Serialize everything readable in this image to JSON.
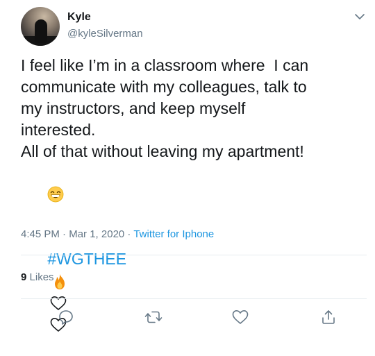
{
  "author": {
    "name": "Kyle",
    "handle": "@kyleSilverman"
  },
  "tweet": {
    "lines": [
      "I feel like I’m in a classroom where  I can",
      "communicate with my colleagues, talk to",
      "my instructors, and keep myself",
      "interested.",
      "All of that without leaving my apartment!"
    ],
    "emoji_line": "grinning-face-emoji",
    "hashtag": "#WGTHEE",
    "hashtag_icons": [
      "fire-emoji",
      "white-heart-emoji",
      "white-heart-emoji"
    ]
  },
  "meta": {
    "time": "4:45 PM",
    "separator1": " · ",
    "date": "Mar 1, 2020",
    "separator2": " · ",
    "source": "Twitter for Iphone"
  },
  "stats": {
    "likes_count": "9",
    "likes_label": "Likes"
  },
  "actions": [
    "reply-icon",
    "retweet-icon",
    "like-icon",
    "share-icon"
  ],
  "colors": {
    "link": "#1b95e0",
    "secondary_text": "#657786",
    "primary_text": "#14171a",
    "divider": "#e6ecf0",
    "icon": "#657786"
  }
}
